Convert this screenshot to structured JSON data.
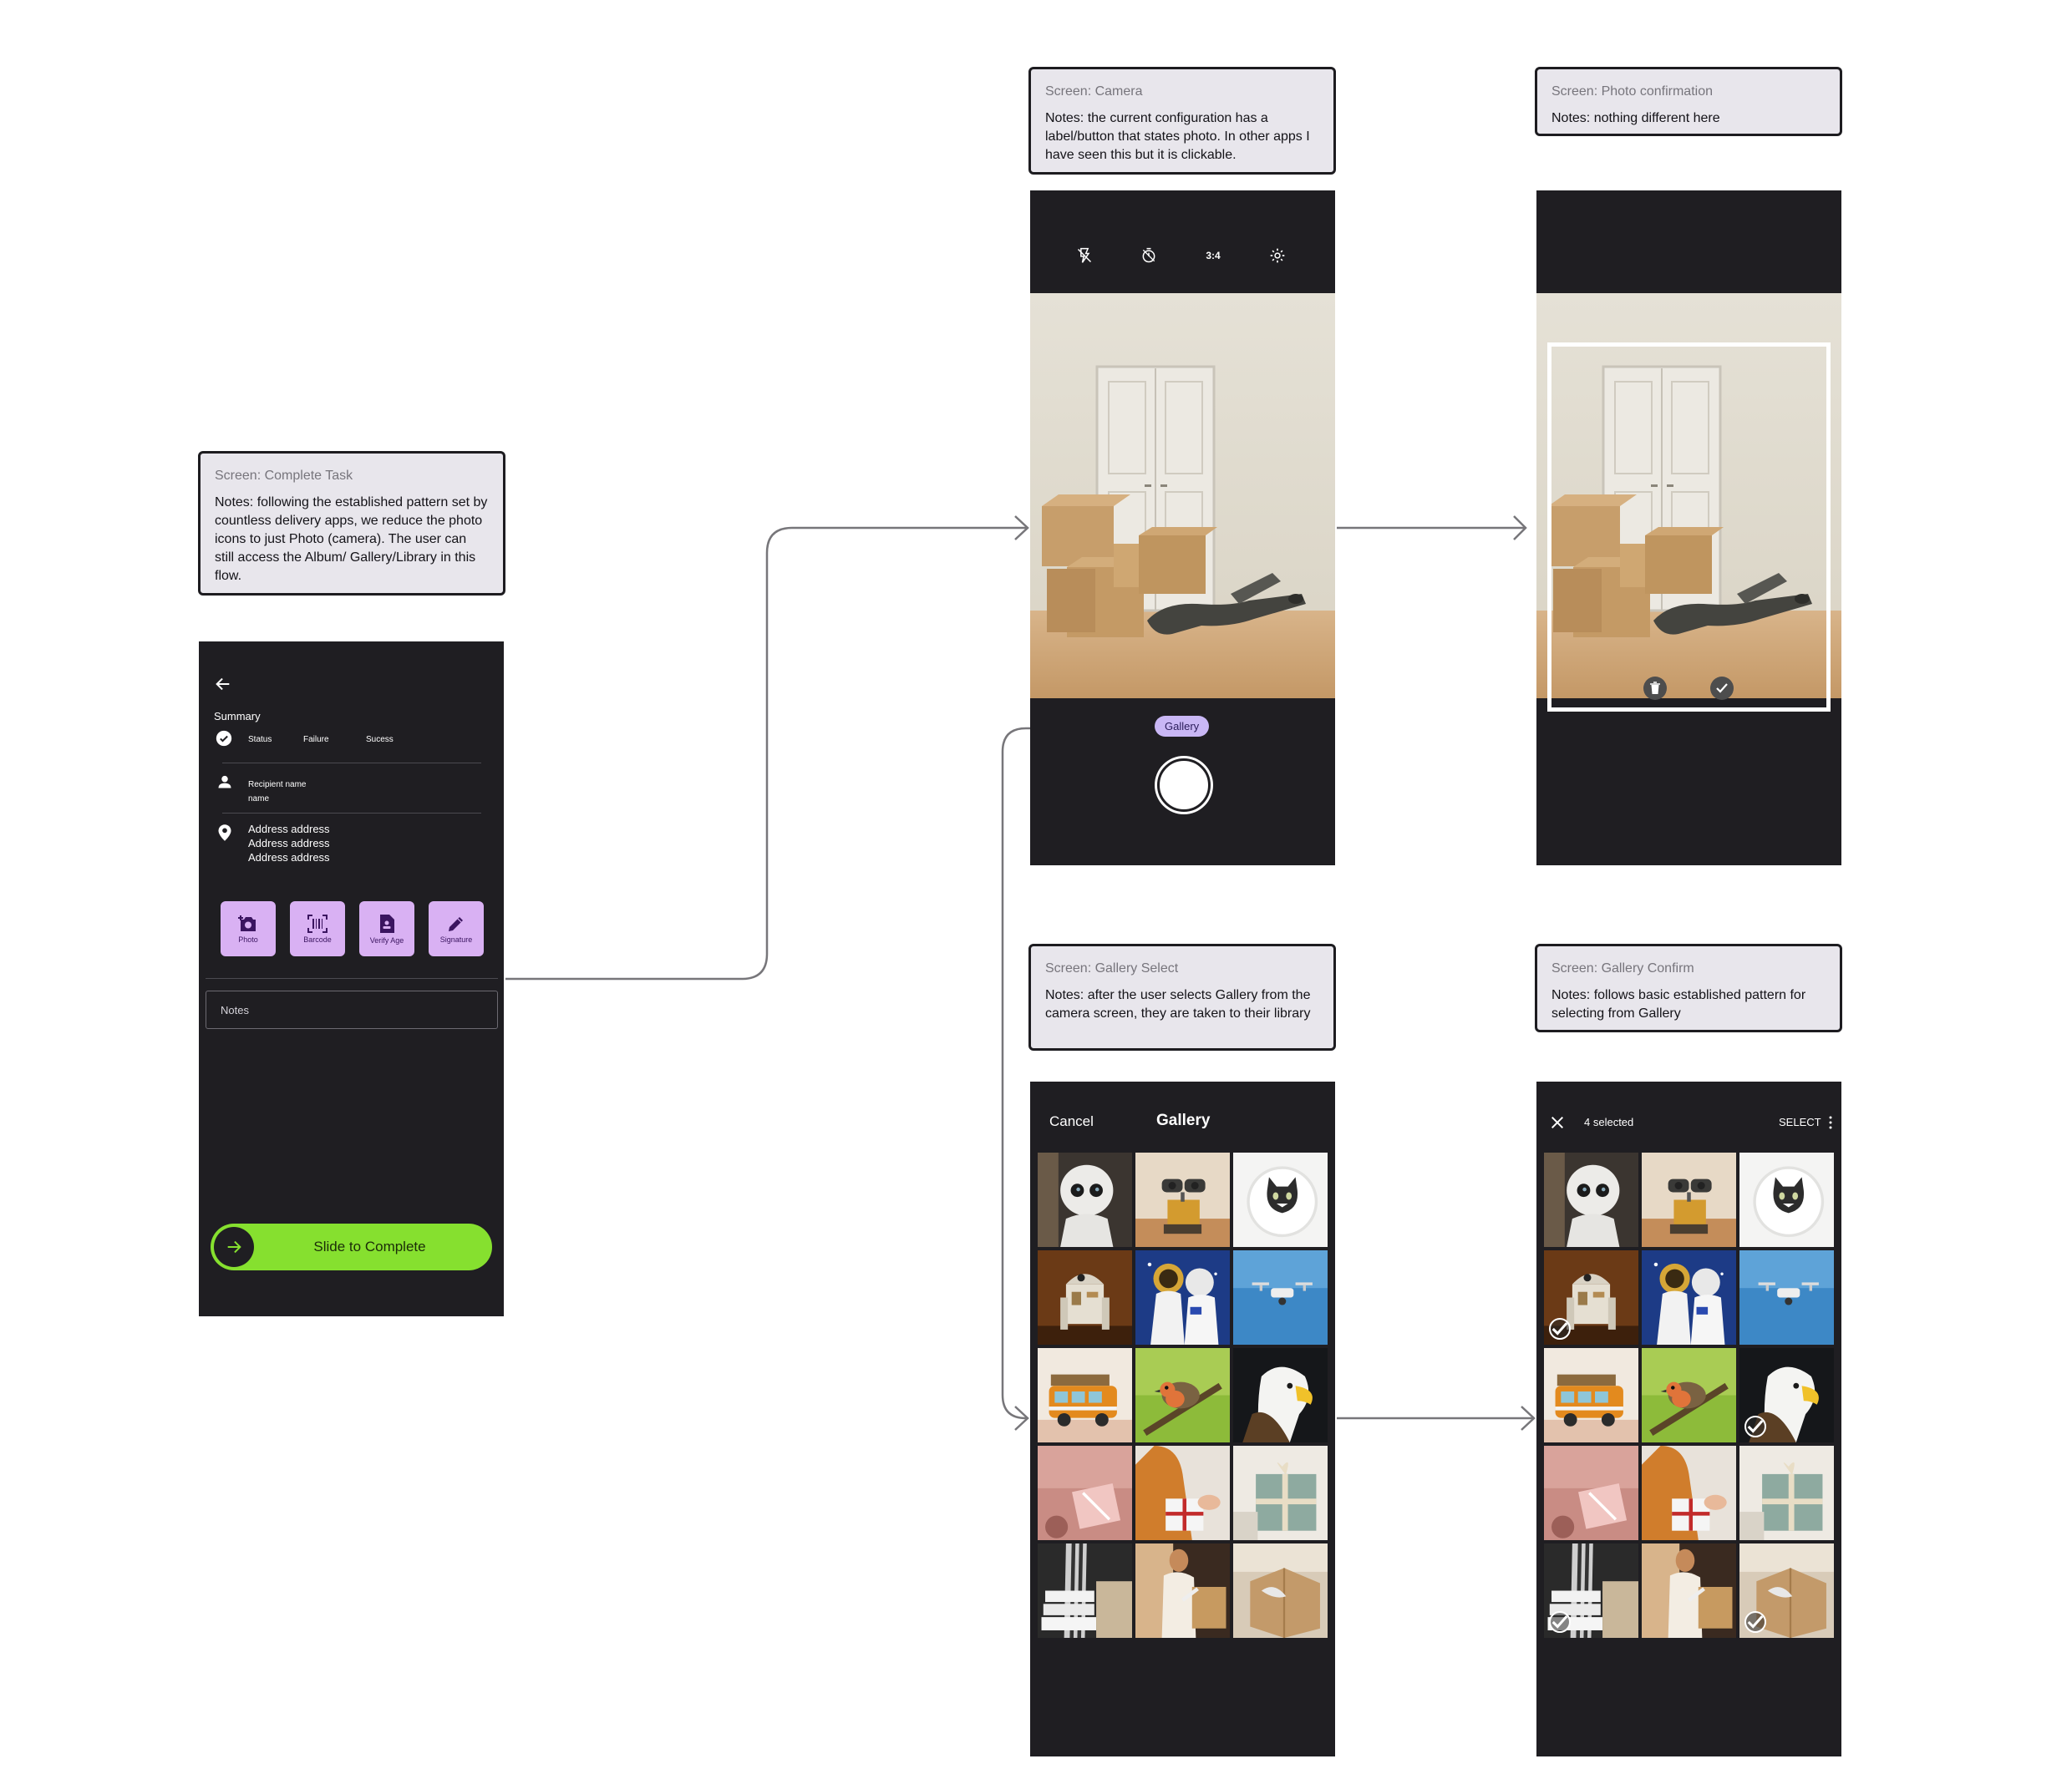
{
  "notes": {
    "complete_task": {
      "title": "Screen: Complete Task",
      "body": "Notes: following the established pattern set by countless delivery apps, we reduce the photo icons to just Photo (camera). The user can still  access the Album/ Gallery/Library in this flow."
    },
    "camera": {
      "title": "Screen: Camera",
      "body": "Notes: the current configuration has a label/button that states photo. In other apps I have seen this but it is clickable."
    },
    "photo_confirmation": {
      "title": "Screen: Photo confirmation",
      "body": "Notes: nothing different here"
    },
    "gallery_select": {
      "title": "Screen: Gallery Select",
      "body": "Notes: after the user selects Gallery from the camera screen, they are taken to their library"
    },
    "gallery_confirm": {
      "title": "Screen: Gallery Confirm",
      "body": "Notes: follows basic established pattern for selecting from Gallery"
    }
  },
  "complete_task": {
    "summary_label": "Summary",
    "status_items": [
      "Status",
      "Failure",
      "Sucess"
    ],
    "recipient": "Recipient name\nname",
    "address": "Address address\nAddress address\nAddress address",
    "actions": [
      {
        "label": "Photo",
        "icon": "camera-plus-icon"
      },
      {
        "label": "Barcode",
        "icon": "barcode-scan-icon"
      },
      {
        "label": "Verify Age",
        "icon": "id-document-icon"
      },
      {
        "label": "Signature",
        "icon": "pen-icon"
      }
    ],
    "notes_placeholder": "Notes",
    "slide_label": "Slide to Complete",
    "colors": {
      "action_bg": "#d9b1f3",
      "slide_bg": "#86e02f",
      "screen_bg": "#1f1e22"
    }
  },
  "camera": {
    "top_icons": [
      "flash-off-icon",
      "timer-icon",
      "aspect-ratio-icon",
      "settings-gear-icon"
    ],
    "ratio_label": "3:4",
    "gallery_label": "Gallery",
    "pill_color": "#c9b7f5"
  },
  "photo_confirmation": {
    "icons": [
      "trash-icon",
      "confirm-check-icon"
    ]
  },
  "gallery_select": {
    "cancel_label": "Cancel",
    "title": "Gallery"
  },
  "gallery_confirm": {
    "selected_label": "4 selected",
    "select_label": "SELECT",
    "selected_indices": [
      3,
      8,
      12,
      14
    ]
  },
  "gallery_photos": [
    "robot",
    "wall-e",
    "cat",
    "r2d2",
    "astronaut",
    "drone",
    "van",
    "bird",
    "eagle",
    "gift-pink",
    "gift-woman",
    "gift-green",
    "boxes-stack",
    "woman-box",
    "carton"
  ]
}
